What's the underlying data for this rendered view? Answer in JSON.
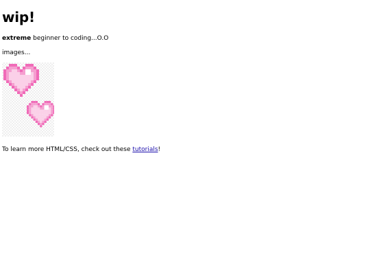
{
  "page": {
    "title": "wip!",
    "intro_bold": "extreme",
    "intro_rest": " beginner to coding...O.O",
    "images_label": "images...",
    "image_icon": "pixel-hearts",
    "colors": {
      "heart_dark": "#f06bb8",
      "heart_mid": "#f59fd0",
      "heart_light": "#fbd0e8",
      "shine": "#ffffff",
      "link": "#1a0dab"
    },
    "footer_prefix": "To learn more HTML/CSS, check out these ",
    "footer_link": "tutorials",
    "footer_suffix": "!"
  }
}
